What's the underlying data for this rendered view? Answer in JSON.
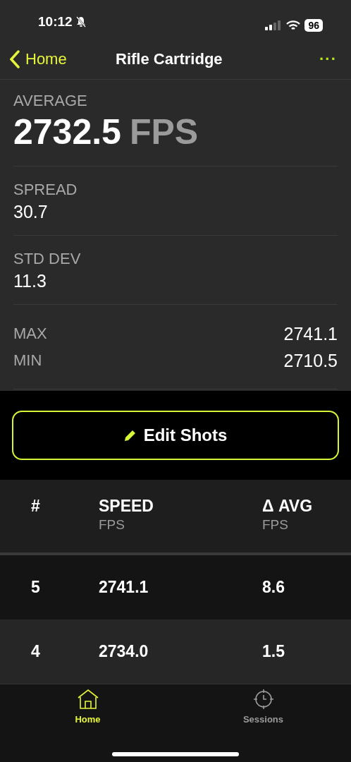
{
  "status_bar": {
    "time": "10:12",
    "battery": "96"
  },
  "nav": {
    "back": "Home",
    "title": "Rifle Cartridge",
    "menu": "···"
  },
  "average": {
    "label": "AVERAGE",
    "value": "2732.5",
    "unit": "FPS"
  },
  "stats": [
    {
      "label": "SPREAD",
      "value": "30.7"
    },
    {
      "label": "STD DEV",
      "value": "11.3"
    }
  ],
  "range": [
    {
      "label": "MAX",
      "value": "2741.1"
    },
    {
      "label": "MIN",
      "value": "2710.5"
    }
  ],
  "edit_button": "Edit Shots",
  "table": {
    "columns": [
      {
        "title": "#"
      },
      {
        "title": "SPEED",
        "unit": "FPS"
      },
      {
        "title": "Δ AVG",
        "unit": "FPS"
      }
    ],
    "rows": [
      [
        "5",
        "2741.1",
        "8.6"
      ],
      [
        "4",
        "2734.0",
        "1.5"
      ]
    ]
  },
  "tabs": [
    {
      "label": "Home",
      "kind": "home",
      "selected": true
    },
    {
      "label": "Sessions",
      "kind": "sessions",
      "selected": false
    }
  ]
}
